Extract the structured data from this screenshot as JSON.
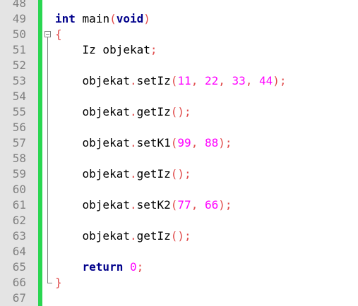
{
  "editor": {
    "lines": [
      {
        "num": "48",
        "tokens": []
      },
      {
        "num": "49",
        "tokens": [
          {
            "t": "int",
            "c": "kw"
          },
          {
            "t": " main",
            "c": ""
          },
          {
            "t": "(",
            "c": "punct"
          },
          {
            "t": "void",
            "c": "kw"
          },
          {
            "t": ")",
            "c": "punct"
          }
        ]
      },
      {
        "num": "50",
        "tokens": [
          {
            "t": "{",
            "c": "punct"
          }
        ]
      },
      {
        "num": "51",
        "tokens": [
          {
            "t": "    Iz objekat",
            "c": ""
          },
          {
            "t": ";",
            "c": "punct"
          }
        ]
      },
      {
        "num": "52",
        "tokens": []
      },
      {
        "num": "53",
        "tokens": [
          {
            "t": "    objekat",
            "c": ""
          },
          {
            "t": ".",
            "c": "punct"
          },
          {
            "t": "setIz",
            "c": ""
          },
          {
            "t": "(",
            "c": "punct"
          },
          {
            "t": "11",
            "c": "num"
          },
          {
            "t": ", ",
            "c": "punct"
          },
          {
            "t": "22",
            "c": "num"
          },
          {
            "t": ", ",
            "c": "punct"
          },
          {
            "t": "33",
            "c": "num"
          },
          {
            "t": ", ",
            "c": "punct"
          },
          {
            "t": "44",
            "c": "num"
          },
          {
            "t": ");",
            "c": "punct"
          }
        ]
      },
      {
        "num": "54",
        "tokens": []
      },
      {
        "num": "55",
        "tokens": [
          {
            "t": "    objekat",
            "c": ""
          },
          {
            "t": ".",
            "c": "punct"
          },
          {
            "t": "getIz",
            "c": ""
          },
          {
            "t": "();",
            "c": "punct"
          }
        ]
      },
      {
        "num": "56",
        "tokens": []
      },
      {
        "num": "57",
        "tokens": [
          {
            "t": "    objekat",
            "c": ""
          },
          {
            "t": ".",
            "c": "punct"
          },
          {
            "t": "setK1",
            "c": ""
          },
          {
            "t": "(",
            "c": "punct"
          },
          {
            "t": "99",
            "c": "num"
          },
          {
            "t": ", ",
            "c": "punct"
          },
          {
            "t": "88",
            "c": "num"
          },
          {
            "t": ");",
            "c": "punct"
          }
        ]
      },
      {
        "num": "58",
        "tokens": []
      },
      {
        "num": "59",
        "tokens": [
          {
            "t": "    objekat",
            "c": ""
          },
          {
            "t": ".",
            "c": "punct"
          },
          {
            "t": "getIz",
            "c": ""
          },
          {
            "t": "();",
            "c": "punct"
          }
        ]
      },
      {
        "num": "60",
        "tokens": []
      },
      {
        "num": "61",
        "tokens": [
          {
            "t": "    objekat",
            "c": ""
          },
          {
            "t": ".",
            "c": "punct"
          },
          {
            "t": "setK2",
            "c": ""
          },
          {
            "t": "(",
            "c": "punct"
          },
          {
            "t": "77",
            "c": "num"
          },
          {
            "t": ", ",
            "c": "punct"
          },
          {
            "t": "66",
            "c": "num"
          },
          {
            "t": ");",
            "c": "punct"
          }
        ]
      },
      {
        "num": "62",
        "tokens": []
      },
      {
        "num": "63",
        "tokens": [
          {
            "t": "    objekat",
            "c": ""
          },
          {
            "t": ".",
            "c": "punct"
          },
          {
            "t": "getIz",
            "c": ""
          },
          {
            "t": "();",
            "c": "punct"
          }
        ]
      },
      {
        "num": "64",
        "tokens": []
      },
      {
        "num": "65",
        "tokens": [
          {
            "t": "    ",
            "c": ""
          },
          {
            "t": "return",
            "c": "kw"
          },
          {
            "t": " ",
            "c": ""
          },
          {
            "t": "0",
            "c": "num"
          },
          {
            "t": ";",
            "c": "punct"
          }
        ]
      },
      {
        "num": "66",
        "tokens": [
          {
            "t": "}",
            "c": "punct"
          }
        ]
      },
      {
        "num": "67",
        "tokens": []
      }
    ]
  },
  "colors": {
    "gutter_bg": "#e4e4e4",
    "change_bar": "#2ad651",
    "keyword": "#00008b",
    "number": "#ff00ff",
    "punctuation": "#e04a4a",
    "line_number": "#808080"
  }
}
